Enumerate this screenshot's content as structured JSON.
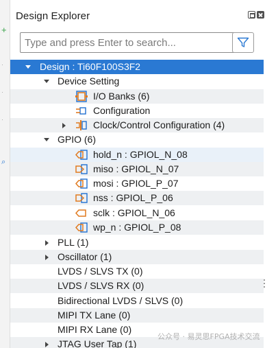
{
  "panel": {
    "title": "Design Explorer",
    "window_buttons": [
      "restore-icon",
      "close-icon"
    ]
  },
  "search": {
    "placeholder": "Type and press Enter to search...",
    "value": "",
    "filter_icon": "filter-icon"
  },
  "tree": {
    "root": "Design : Ti60F100S3F2",
    "device_setting": "Device Setting",
    "io_banks": "I/O Banks (6)",
    "configuration": "Configuration",
    "clock_control": "Clock/Control Configuration (4)",
    "gpio": "GPIO (6)",
    "gpio_items": [
      {
        "label": "hold_n : GPIOL_N_08",
        "icon": "bidir-io-icon"
      },
      {
        "label": "miso : GPIOL_N_07",
        "icon": "input-io-icon"
      },
      {
        "label": "mosi : GPIOL_P_07",
        "icon": "bidir-io-icon"
      },
      {
        "label": "nss : GPIOL_P_06",
        "icon": "input-io-icon"
      },
      {
        "label": "sclk : GPIOL_N_06",
        "icon": "output-io-icon"
      },
      {
        "label": "wp_n : GPIOL_P_08",
        "icon": "bidir-io-icon"
      }
    ],
    "pll": "PLL (1)",
    "oscillator": "Oscillator (1)",
    "lvds_tx": "LVDS / SLVS TX (0)",
    "lvds_rx": "LVDS / SLVS RX (0)",
    "bidir_lvds": "Bidirectional LVDS / SLVS (0)",
    "mipi_tx": "MIPI TX Lane (0)",
    "mipi_rx": "MIPI RX Lane (0)",
    "jtag": "JTAG User Tap (1)"
  },
  "watermark": "公众号 · 易灵思FPGA技术交流",
  "colors": {
    "selection": "#2a79d3",
    "io_icon": "#e07a1f",
    "config_icon": "#1f6fd1"
  }
}
